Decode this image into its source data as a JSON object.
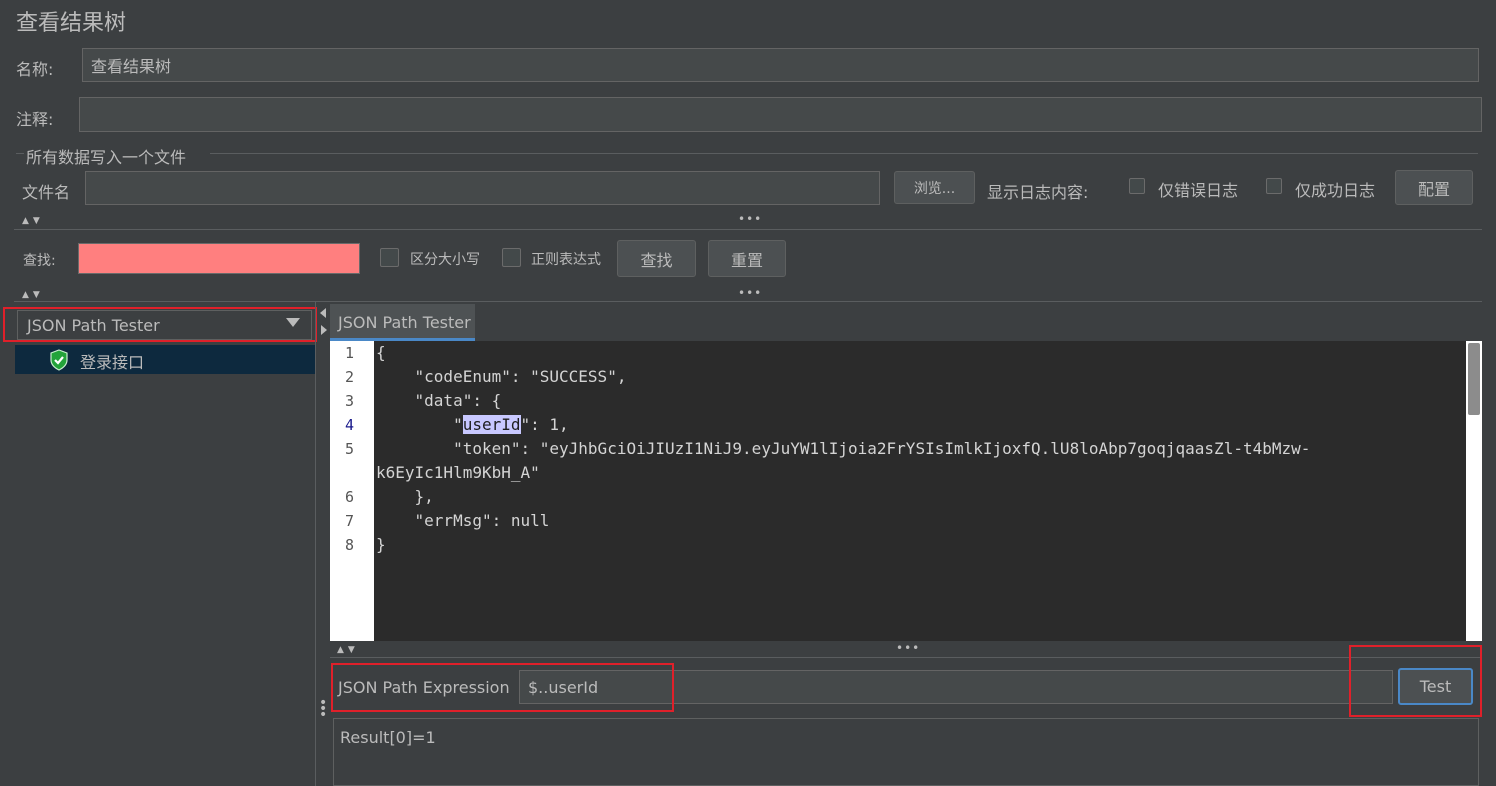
{
  "window": {
    "title": "查看结果树"
  },
  "name_row": {
    "label": "名称:",
    "value": "查看结果树"
  },
  "comment_row": {
    "label": "注释:",
    "value": ""
  },
  "file_section": {
    "legend": "所有数据写入一个文件",
    "file_label": "文件名",
    "file_value": "",
    "browse_label": "浏览...",
    "show_log_label": "显示日志内容:",
    "errors_only_label": "仅错误日志",
    "success_only_label": "仅成功日志",
    "config_label": "配置"
  },
  "search": {
    "label": "查找:",
    "value": "",
    "case_label": "区分大小写",
    "regex_label": "正则表达式",
    "find_label": "查找",
    "reset_label": "重置",
    "field_color": "#ff7f7f"
  },
  "renderer": {
    "selected": "JSON Path Tester"
  },
  "tree": {
    "items": [
      {
        "label": "登录接口",
        "icon": "success-shield-icon"
      }
    ]
  },
  "tab": {
    "label": "JSON Path Tester"
  },
  "editor": {
    "line_numbers": [
      "1",
      "2",
      "3",
      "4",
      "5",
      "6",
      "7",
      "8"
    ],
    "lines": [
      "{",
      "    \"codeEnum\": \"SUCCESS\",",
      "    \"data\": {",
      "        \"",
      "userId",
      "\": 1,",
      "        \"token\": \"eyJhbGciOiJIUzI1NiJ9.eyJuYW1lIjoia2FrYSIsImlkIjoxfQ.lU8loAbp7goqjqaasZl-t4bMzw-",
      "k6EyIc1Hlm9KbH_A\"",
      "    },",
      "    \"errMsg\": null",
      "}"
    ]
  },
  "expression": {
    "label": "JSON Path Expression",
    "value": "$..userId",
    "test_label": "Test"
  },
  "result": {
    "text": "Result[0]=1"
  },
  "colors": {
    "background": "#3c3f41",
    "annotation_red": "#e0202a",
    "selected_row": "#0d293e"
  }
}
